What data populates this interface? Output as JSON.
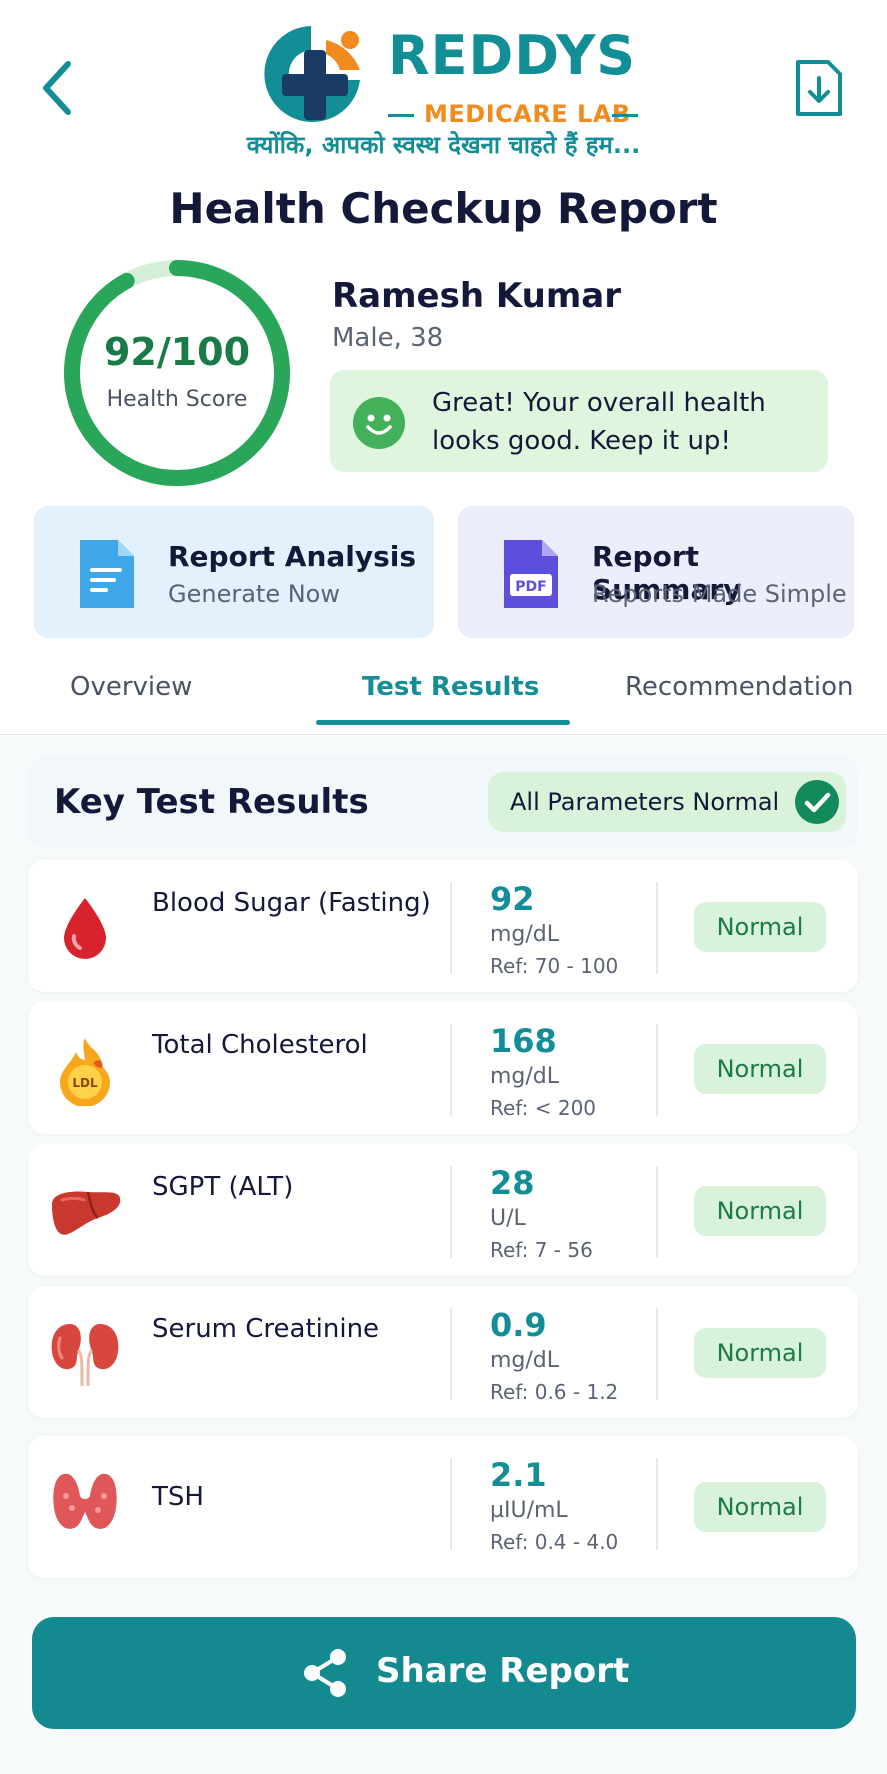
{
  "header": {
    "brand_name": "REDDYS",
    "brand_sub": "MEDICARE LAB",
    "tagline": "क्योंकि, आपको स्वस्थ देखना चाहते हैं हम...",
    "title": "Health Checkup Report"
  },
  "score": {
    "value": "92/100",
    "label": "Health Score",
    "fraction": 0.92
  },
  "patient": {
    "name": "Ramesh Kumar",
    "meta": "Male, 38",
    "message": "Great! Your overall health looks good. Keep it up!"
  },
  "quick_cards": {
    "analysis": {
      "title": "Report Analysis",
      "subtitle": "Generate Now"
    },
    "summary": {
      "title": "Report Summary",
      "subtitle": "Reports Made Simple",
      "icon_text": "PDF"
    }
  },
  "tabs": [
    {
      "label": "Overview",
      "active": false
    },
    {
      "label": "Test Results",
      "active": true
    },
    {
      "label": "Recommendation",
      "active": false
    }
  ],
  "results": {
    "title": "Key Test Results",
    "summary_badge": "All Parameters Normal",
    "rows": [
      {
        "name": "Blood Sugar (Fasting)",
        "value": "92",
        "unit": "mg/dL",
        "ref": "Ref: 70 - 100",
        "status": "Normal",
        "icon": "blood-drop-icon"
      },
      {
        "name": "Total Cholesterol",
        "value": "168",
        "unit": "mg/dL",
        "ref": "Ref: < 200",
        "status": "Normal",
        "icon": "cholesterol-icon",
        "icon_text": "LDL"
      },
      {
        "name": "SGPT (ALT)",
        "value": "28",
        "unit": "U/L",
        "ref": "Ref: 7 - 56",
        "status": "Normal",
        "icon": "liver-icon"
      },
      {
        "name": "Serum Creatinine",
        "value": "0.9",
        "unit": "mg/dL",
        "ref": "Ref: 0.6 - 1.2",
        "status": "Normal",
        "icon": "kidney-icon"
      },
      {
        "name": "TSH",
        "value": "2.1",
        "unit": "µIU/mL",
        "ref": "Ref: 0.4 - 4.0",
        "status": "Normal",
        "icon": "thyroid-icon"
      }
    ]
  },
  "share": {
    "label": "Share Report"
  },
  "colors": {
    "brand_teal": "#138e97",
    "brand_orange": "#f28b1e",
    "normal_green": "#1a7a48",
    "normal_bg": "#d8f3da"
  }
}
